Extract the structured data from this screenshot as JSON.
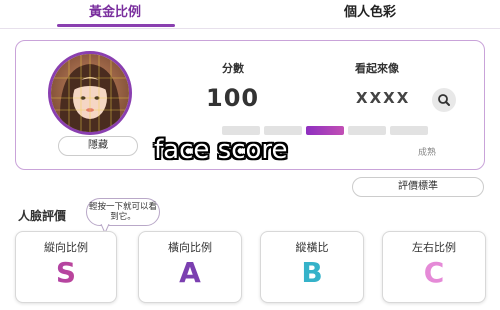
{
  "tabs": [
    {
      "label": "黃金比例",
      "active": true
    },
    {
      "label": "個人色彩",
      "active": false
    }
  ],
  "score_card": {
    "score_label": "分數",
    "score_value": "100",
    "lookalike_label": "看起來像",
    "lookalike_value": "XXXX",
    "hide_label": "隱藏",
    "mature_label": "成熟",
    "meter_level_index": 2,
    "meter_segments": 5
  },
  "overlay_caption": "face score",
  "standard_button": "評價標準",
  "face_eval": {
    "title": "人臉評價",
    "tooltip": "輕按一下就可以看到它。"
  },
  "grades": [
    {
      "label": "縱向比例",
      "letter": "S",
      "color_a": "#9b3fb8",
      "color_b": "#d24a86"
    },
    {
      "label": "橫向比例",
      "letter": "A",
      "color_a": "#7b3fb0",
      "color_b": "#7b3fb0"
    },
    {
      "label": "縱橫比",
      "letter": "B",
      "color_a": "#35b2c9",
      "color_b": "#35b2c9"
    },
    {
      "label": "左右比例",
      "letter": "C",
      "color_a": "#e58ad7",
      "color_b": "#e58ad7"
    }
  ],
  "colors": {
    "accent": "#8a3fb0",
    "card_border": "#c9a3d9"
  }
}
